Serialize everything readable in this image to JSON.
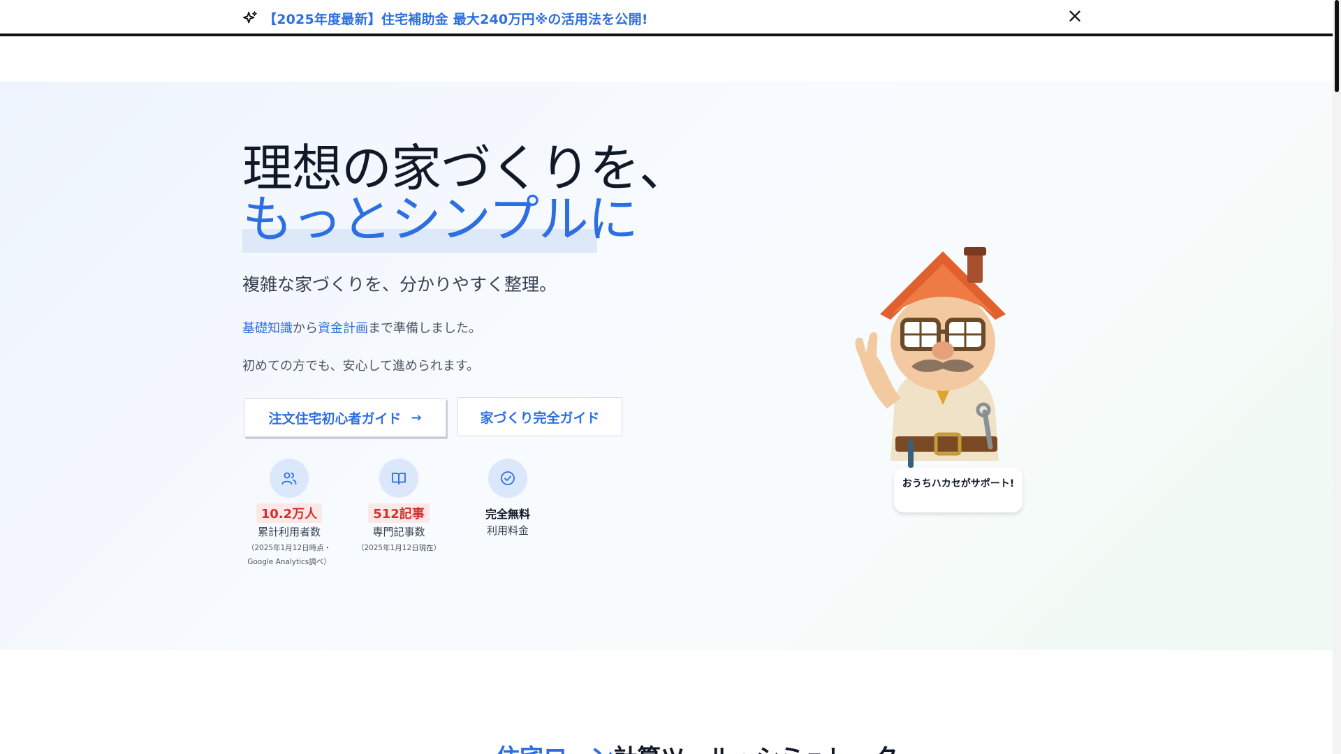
{
  "announcement": {
    "text": "【2025年度最新】住宅補助金 最大240万円※の活用法を公開!",
    "icon": "sparkle-icon",
    "close_icon": "close-icon"
  },
  "hero": {
    "headline_line1": "理想の家づくりを、",
    "headline_line2": "もっとシンプルに",
    "subtitle": "複雑な家づくりを、分かりやすく整理。",
    "description": {
      "link1": "基礎知識",
      "mid1": "から",
      "link2": "資金計画",
      "tail": "まで準備しました。"
    },
    "description2": "初めての方でも、安心して進められます。",
    "primary_button": "注文住宅初心者ガイド",
    "primary_button_arrow": "→",
    "secondary_button": "家づくり完全ガイド",
    "stats": [
      {
        "icon": "users-icon",
        "value": "10.2万人",
        "label": "累計利用者数",
        "note_line1": "（2025年1月12日時点・",
        "note_line2": "Google Analytics調べ）"
      },
      {
        "icon": "book-icon",
        "value": "512記事",
        "label": "専門記事数",
        "note_line1": "（2025年1月12日現在）"
      },
      {
        "icon": "check-circle-icon",
        "value": "完全無料",
        "label": "利用料金"
      }
    ],
    "mascot_speech": "おうちハカセがサポート!"
  },
  "next_section": {
    "heading_accent": "住宅ローン",
    "heading_rest": "計算ツール・シミュレーター"
  },
  "colors": {
    "accent": "#2d6fe0",
    "badge_text": "#d32f2f",
    "badge_bg": "#fde8e8",
    "icon_circle": "#dbe8fb"
  }
}
